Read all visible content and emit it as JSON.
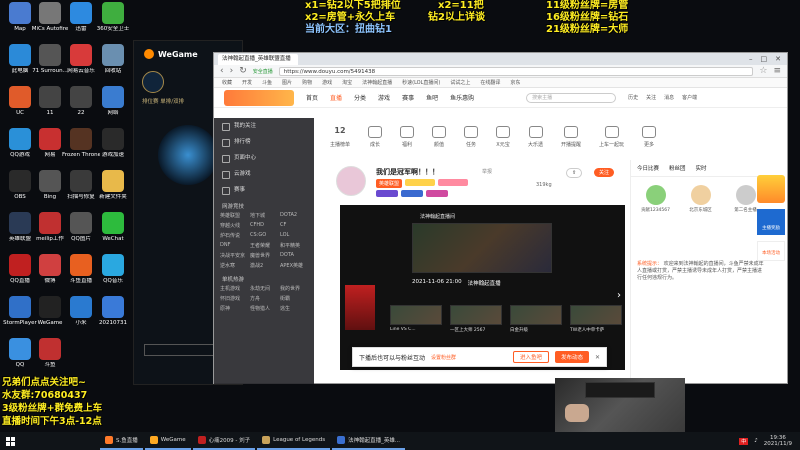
{
  "overlay": {
    "top_left_lines": [
      "x1=钻2以下5把排位",
      "x2=房管+永久上车",
      "当前大区：扭曲钻1"
    ],
    "top_mid_lines": [
      "x2=11把",
      "钻2以上详谈"
    ],
    "top_right_lines": [
      "11级粉丝牌=房管",
      "16级粉丝牌=钻石",
      "21级粉丝牌=大师"
    ],
    "bottom_left_lines": [
      "兄弟们点点关注吧~",
      "水友群:70680437",
      "3级粉丝牌+群免费上车",
      "直播时间下午3点-12点"
    ]
  },
  "desktop_icons": [
    {
      "label": "Map",
      "color": "#4a7bd0"
    },
    {
      "label": "MiCs Autofire",
      "color": "#777"
    },
    {
      "label": "迅雷",
      "color": "#2d8ae0"
    },
    {
      "label": "360安全卫士",
      "color": "#3fae3f"
    },
    {
      "label": "此电脑",
      "color": "#2b8ad8"
    },
    {
      "label": "71 Surroun...",
      "color": "#555"
    },
    {
      "label": "网易云音乐",
      "color": "#d83a3a"
    },
    {
      "label": "回收站",
      "color": "#6a8fb0"
    },
    {
      "label": "UC",
      "color": "#e05b2a"
    },
    {
      "label": "11",
      "color": "#444"
    },
    {
      "label": "22",
      "color": "#444"
    },
    {
      "label": "网络",
      "color": "#3a7cd0"
    },
    {
      "label": "QQ游戏",
      "color": "#2a90d8"
    },
    {
      "label": "网易",
      "color": "#c83030"
    },
    {
      "label": "Frozen Throne",
      "color": "#553322"
    },
    {
      "label": "游戏加速",
      "color": "#2a2a2a"
    },
    {
      "label": "OBS",
      "color": "#2a2a2a"
    },
    {
      "label": "Bing",
      "color": "#555"
    },
    {
      "label": "扫描与修复",
      "color": "#3a3a3a"
    },
    {
      "label": "新建文件夹",
      "color": "#e8b94a"
    },
    {
      "label": "英雄联盟",
      "color": "#2a3a55"
    },
    {
      "label": "meilip工作",
      "color": "#c03030"
    },
    {
      "label": "QQ图片",
      "color": "#555"
    },
    {
      "label": "WeChat",
      "color": "#2dbb3d"
    },
    {
      "label": "QQ直播",
      "color": "#c02020"
    },
    {
      "label": "微博",
      "color": "#d04040"
    },
    {
      "label": "斗鱼直播",
      "color": "#e86020"
    },
    {
      "label": "QQ音乐",
      "color": "#2aa8e0"
    },
    {
      "label": "StormPlayer",
      "color": "#3070c8"
    },
    {
      "label": "WeGame",
      "color": "#222"
    },
    {
      "label": "小米",
      "color": "#2a7ad0"
    },
    {
      "label": "20210731",
      "color": "#3a7ad8"
    },
    {
      "label": "QQ",
      "color": "#3a90e0"
    },
    {
      "label": "斗鱼",
      "color": "#c03030"
    }
  ],
  "wegame": {
    "brand": "WeGame",
    "lol_label": "排位赛  单排/双排"
  },
  "browser": {
    "tab_title": "法神翰起直播_英雄联盟直播",
    "address": "https://www.douyu.com/5491438",
    "security": "安全直播",
    "bookmarks": [
      "收藏",
      "开发",
      "斗鱼",
      "图片",
      "购物",
      "游戏",
      "淘宝",
      "法神翰起直播",
      "秒速(LOL直播间)",
      "试试之上",
      "在线翻译",
      "京东"
    ],
    "nav": [
      "首页",
      "直播",
      "分类",
      "游戏",
      "赛事",
      "鱼吧",
      "鱼乐惠购"
    ],
    "search_placeholder": "搜索主播",
    "right_nav": [
      "历史",
      "关注",
      "消息",
      "客户端"
    ]
  },
  "menu": {
    "items": [
      "我的关注",
      "排行榜",
      "页面中心",
      "云游戏",
      "赛事"
    ],
    "section1": "网游竞技",
    "grid1": [
      "英雄联盟",
      "地下城",
      "DOTA2",
      "穿越火线",
      "CFHD",
      "CF",
      "炉石传说",
      "CS:GO",
      "LOL",
      "DNF",
      "王者荣耀",
      "和平精英",
      "决战平安京",
      "魔兽世界",
      "DOTA",
      "逆水寒",
      "激战2",
      "APEX英雄"
    ],
    "section2": "单机热游",
    "grid2": [
      "主机游戏",
      "永劫无间",
      "我的世界",
      "怀旧游戏",
      "方舟",
      "街霸",
      "原神",
      "怪物猎人",
      "逃生"
    ]
  },
  "categories": [
    {
      "label": "主播榜单",
      "count": "12"
    },
    {
      "label": "成长"
    },
    {
      "label": "福利"
    },
    {
      "label": "颜值"
    },
    {
      "label": "任务"
    },
    {
      "label": "X元宝"
    },
    {
      "label": "大乐透"
    },
    {
      "label": "开播提醒"
    },
    {
      "label": "上车一起玩"
    },
    {
      "label": "更多"
    }
  ],
  "stream": {
    "title": "我们是冠军啊！！！",
    "tag_category": "英雄联盟",
    "follow_label": "关注",
    "fans_count": "319kg",
    "report": "举报",
    "in_player_title": "法神翰起直播间",
    "video_date": "2021-11-06 21:00",
    "video_name": "法神翰起直播",
    "video_tags": [
      "Line VS C...",
      "一区上大师 2567",
      "白金升级",
      "TW老人中单卡萨"
    ],
    "popup_text": "下播后也可以与粉丝互动",
    "popup_link": "设置粉丝群",
    "popup_btn1": "进入鱼吧",
    "popup_btn2": "发布动态"
  },
  "right_panel": {
    "tabs": [
      "今日比赛",
      "粉丝团",
      "实时"
    ],
    "contributors": [
      "贡献1234567",
      "北京东城区",
      "第二名主播"
    ],
    "announcement_label": "系统提示：",
    "announcement": "欢迎来到法神翰起的直播间，斗鱼严禁未成年人直播或打赏，严禁主播诱导未成年人打赏，严禁主播进行任何违规行为。"
  },
  "side_badges": [
    "主播奖励",
    "本场活动"
  ],
  "taskbar": {
    "items": [
      {
        "label": "S.鱼直播",
        "color": "#ff7a2a"
      },
      {
        "label": "WeGame",
        "color": "#ffaa22"
      },
      {
        "label": "心痛2009 - 刘子",
        "color": "#c02020"
      },
      {
        "label": "League of Legends",
        "color": "#c8a25a"
      },
      {
        "label": "法神翰起直播_英雄...",
        "color": "#3a6fd0"
      }
    ],
    "time": "19:36",
    "date": "2021/11/9",
    "ime": "中"
  }
}
